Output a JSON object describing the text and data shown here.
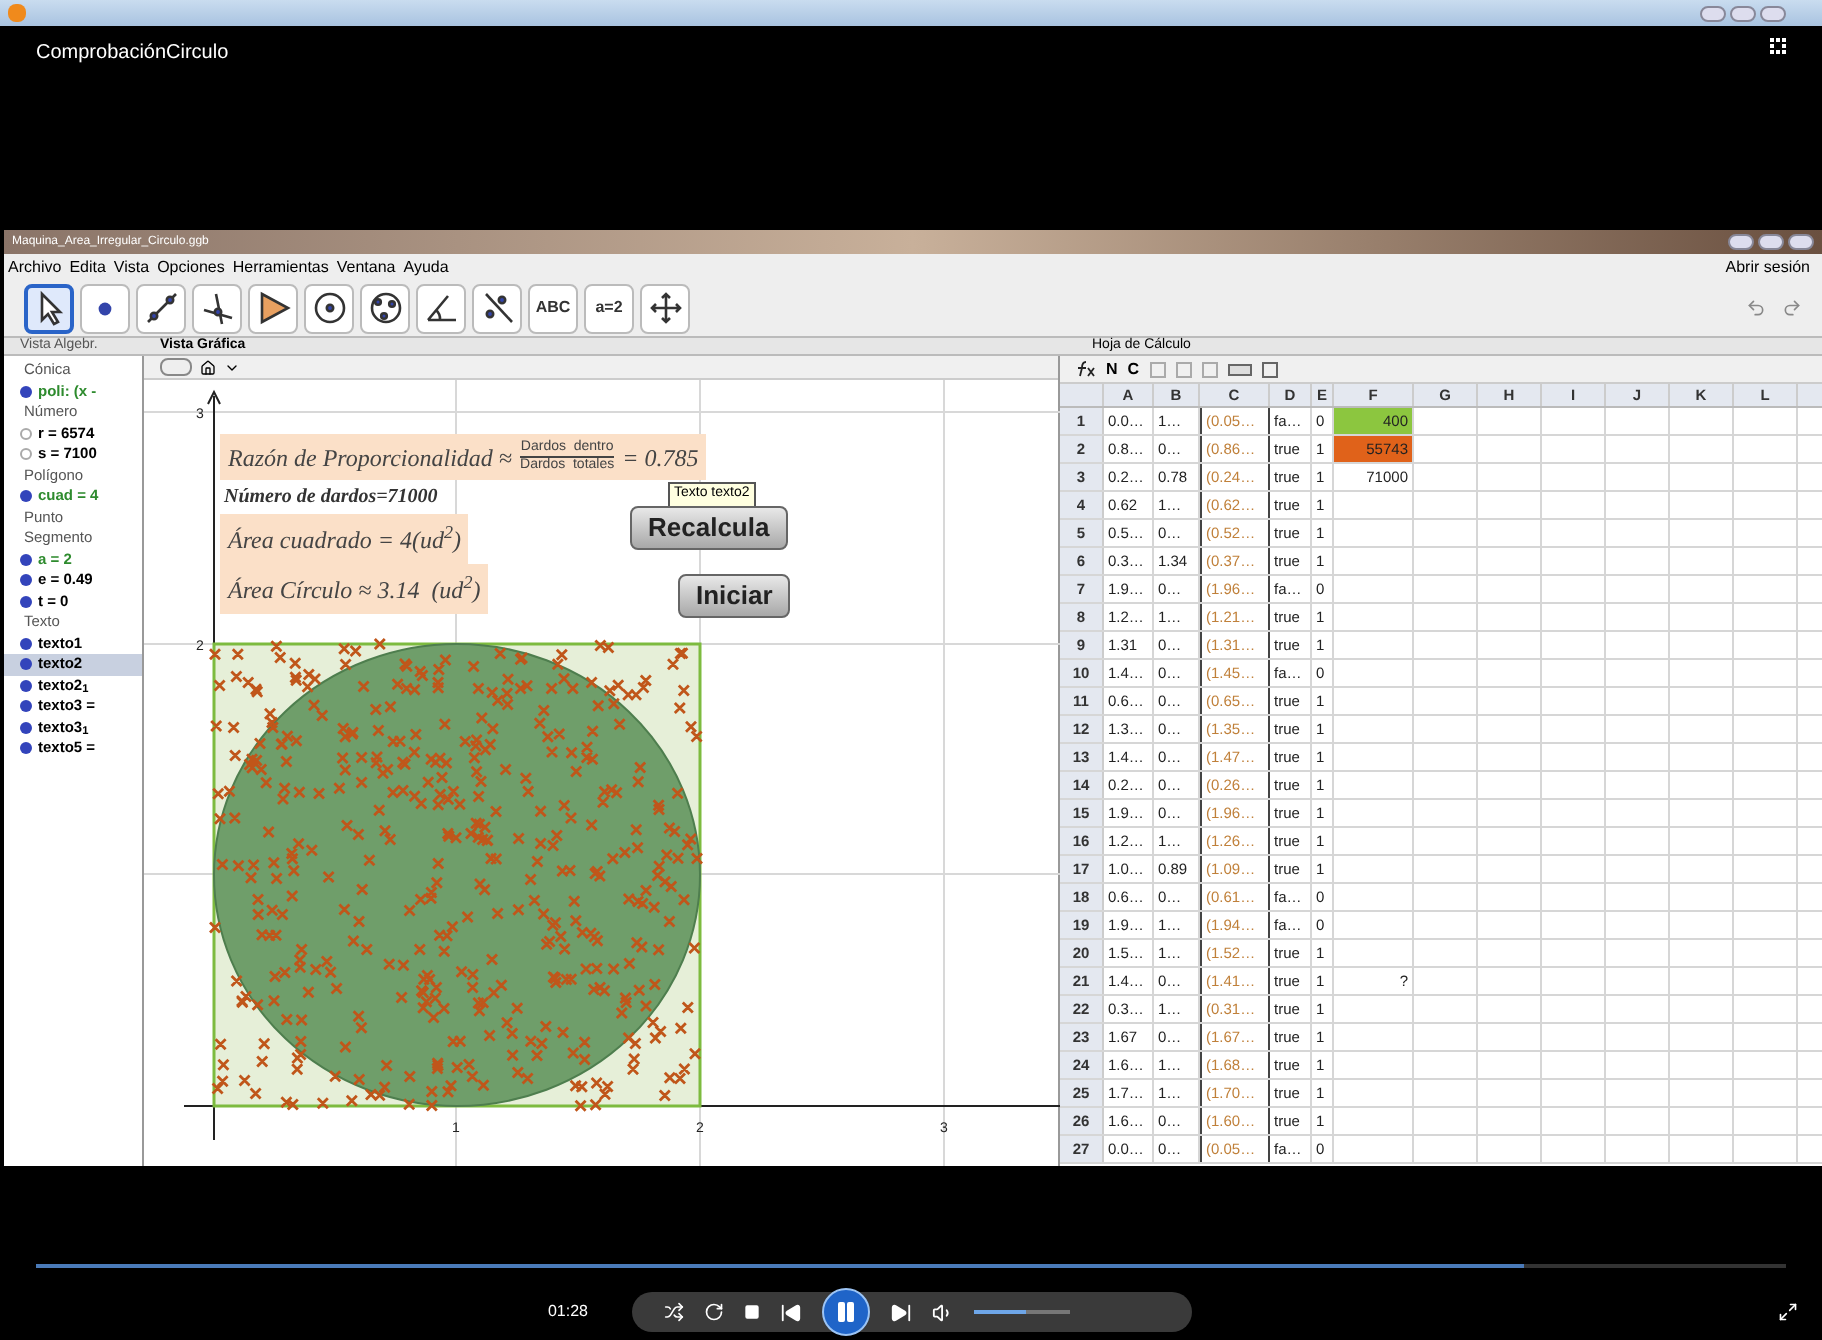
{
  "player": {
    "video_title": "ComprobaciónCirculo",
    "time": "01:28",
    "playing": true,
    "progress": {
      "level": 0.85
    },
    "volume": {
      "level": 0.55
    }
  },
  "app": {
    "file_title": "Maquina_Area_Irregular_Circulo.ggb",
    "menu": [
      "Archivo",
      "Edita",
      "Vista",
      "Opciones",
      "Herramientas",
      "Ventana",
      "Ayuda"
    ],
    "sign_in": "Abrir sesión",
    "tools": [
      {
        "kind": "pointer",
        "selected": true
      },
      {
        "kind": "point",
        "selected": false
      },
      {
        "kind": "line",
        "selected": false
      },
      {
        "kind": "perpendicular",
        "selected": false
      },
      {
        "kind": "polygon",
        "selected": false
      },
      {
        "kind": "circle",
        "selected": false
      },
      {
        "kind": "circle3",
        "selected": false
      },
      {
        "kind": "angle",
        "selected": false
      },
      {
        "kind": "reflect",
        "selected": false
      },
      {
        "kind": "text",
        "label": "ABC",
        "selected": false
      },
      {
        "kind": "slider",
        "label": "a=2",
        "selected": false
      },
      {
        "kind": "move",
        "selected": false
      }
    ]
  },
  "algebra": {
    "title": "Vista Algebr.",
    "groups": [
      {
        "label": "Cónica",
        "children": [
          {
            "text": "poli: (x -",
            "color": "#2e8b2e",
            "visible": true,
            "selected": false
          }
        ]
      },
      {
        "label": "Número",
        "children": [
          {
            "text": "r = 6574",
            "color": "#000000",
            "visible": false,
            "selected": false
          },
          {
            "text": "s = 7100",
            "color": "#000000",
            "visible": false,
            "selected": false
          }
        ]
      },
      {
        "label": "Polígono",
        "children": [
          {
            "text": "cuad = 4",
            "color": "#2e8b2e",
            "visible": true,
            "selected": false
          }
        ]
      },
      {
        "label": "Punto"
      },
      {
        "label": "Segmento",
        "children": [
          {
            "text": "a = 2",
            "color": "#2e8b2e",
            "visible": true,
            "selected": false
          },
          {
            "text": "e = 0.49",
            "color": "#000000",
            "visible": true,
            "selected": false
          },
          {
            "text": "t = 0",
            "color": "#000000",
            "visible": true,
            "selected": false
          }
        ]
      },
      {
        "label": "Texto",
        "children": [
          {
            "text": "texto1",
            "color": "#000000",
            "visible": true,
            "selected": false
          },
          {
            "text": "texto2",
            "color": "#000000",
            "visible": true,
            "selected": true
          },
          {
            "text": "texto2$_{1}$",
            "color": "#000000",
            "visible": true,
            "selected": false
          },
          {
            "text": "texto3 =",
            "color": "#000000",
            "visible": true,
            "selected": false
          },
          {
            "text": "texto3$_{1}$",
            "color": "#000000",
            "visible": true,
            "selected": false
          },
          {
            "text": "texto5 =",
            "color": "#000000",
            "visible": true,
            "selected": false
          }
        ]
      }
    ]
  },
  "graphics": {
    "title": "Vista Gráfica",
    "ratio": {
      "label": "Razón de Proporcionalidad ≈",
      "numerator": "Dardos  dentro",
      "denominator": "Dardos  totales",
      "value": "= 0.785"
    },
    "darts": "Número de dardos=71000",
    "square_area": "Área cuadrado = 4(ud$^{2}$)",
    "circle_area": "Área Círculo ≈ 3.14  (ud$^{2}$)",
    "tooltip": "Texto texto2",
    "buttons": [
      "Recalcula",
      "Iniciar"
    ],
    "y_ticks": [
      "3",
      "2"
    ],
    "x_ticks": [
      "1",
      "2",
      "3"
    ]
  },
  "sheet": {
    "title": "Hoja de Cálculo",
    "toolbar": [
      "N",
      "C"
    ],
    "columns": [
      "A",
      "B",
      "C",
      "D",
      "E",
      "F",
      "G",
      "H",
      "I",
      "J",
      "K",
      "L"
    ],
    "rows": [
      {
        "n": "1",
        "cells": [
          "0.0…",
          "1…",
          "(0.05…",
          "fa…",
          "0",
          "400"
        ],
        "color": "#8cc63f"
      },
      {
        "n": "2",
        "cells": [
          "0.8…",
          "0…",
          "(0.86…",
          "true",
          "1",
          "55743"
        ],
        "color": "#e0621a"
      },
      {
        "n": "3",
        "cells": [
          "0.2…",
          "0.78",
          "(0.24…",
          "true",
          "1",
          "71000"
        ]
      },
      {
        "n": "4",
        "cells": [
          "0.62",
          "1…",
          "(0.62…",
          "true",
          "1"
        ]
      },
      {
        "n": "5",
        "cells": [
          "0.5…",
          "0…",
          "(0.52…",
          "true",
          "1"
        ]
      },
      {
        "n": "6",
        "cells": [
          "0.3…",
          "1.34",
          "(0.37…",
          "true",
          "1"
        ]
      },
      {
        "n": "7",
        "cells": [
          "1.9…",
          "0…",
          "(1.96…",
          "fa…",
          "0"
        ]
      },
      {
        "n": "8",
        "cells": [
          "1.2…",
          "1…",
          "(1.21…",
          "true",
          "1"
        ]
      },
      {
        "n": "9",
        "cells": [
          "1.31",
          "0…",
          "(1.31…",
          "true",
          "1"
        ]
      },
      {
        "n": "10",
        "cells": [
          "1.4…",
          "0…",
          "(1.45…",
          "fa…",
          "0"
        ]
      },
      {
        "n": "11",
        "cells": [
          "0.6…",
          "0…",
          "(0.65…",
          "true",
          "1"
        ]
      },
      {
        "n": "12",
        "cells": [
          "1.3…",
          "0…",
          "(1.35…",
          "true",
          "1"
        ]
      },
      {
        "n": "13",
        "cells": [
          "1.4…",
          "0…",
          "(1.47…",
          "true",
          "1"
        ]
      },
      {
        "n": "14",
        "cells": [
          "0.2…",
          "0…",
          "(0.26…",
          "true",
          "1"
        ]
      },
      {
        "n": "15",
        "cells": [
          "1.9…",
          "0…",
          "(1.96…",
          "true",
          "1"
        ]
      },
      {
        "n": "16",
        "cells": [
          "1.2…",
          "1…",
          "(1.26…",
          "true",
          "1"
        ]
      },
      {
        "n": "17",
        "cells": [
          "1.0…",
          "0.89",
          "(1.09…",
          "true",
          "1"
        ]
      },
      {
        "n": "18",
        "cells": [
          "0.6…",
          "0…",
          "(0.61…",
          "fa…",
          "0"
        ]
      },
      {
        "n": "19",
        "cells": [
          "1.9…",
          "1…",
          "(1.94…",
          "fa…",
          "0"
        ]
      },
      {
        "n": "20",
        "cells": [
          "1.5…",
          "1…",
          "(1.52…",
          "true",
          "1"
        ]
      },
      {
        "n": "21",
        "cells": [
          "1.4…",
          "0…",
          "(1.41…",
          "true",
          "1",
          "?"
        ]
      },
      {
        "n": "22",
        "cells": [
          "0.3…",
          "1…",
          "(0.31…",
          "true",
          "1"
        ]
      },
      {
        "n": "23",
        "cells": [
          "1.67",
          "0…",
          "(1.67…",
          "true",
          "1"
        ]
      },
      {
        "n": "24",
        "cells": [
          "1.6…",
          "1…",
          "(1.68…",
          "true",
          "1"
        ]
      },
      {
        "n": "25",
        "cells": [
          "1.7…",
          "1…",
          "(1.70…",
          "true",
          "1"
        ]
      },
      {
        "n": "26",
        "cells": [
          "1.6…",
          "0…",
          "(1.60…",
          "true",
          "1"
        ]
      },
      {
        "n": "27",
        "cells": [
          "0.0…",
          "0…",
          "(0.05…",
          "fa…",
          "0"
        ]
      }
    ]
  }
}
